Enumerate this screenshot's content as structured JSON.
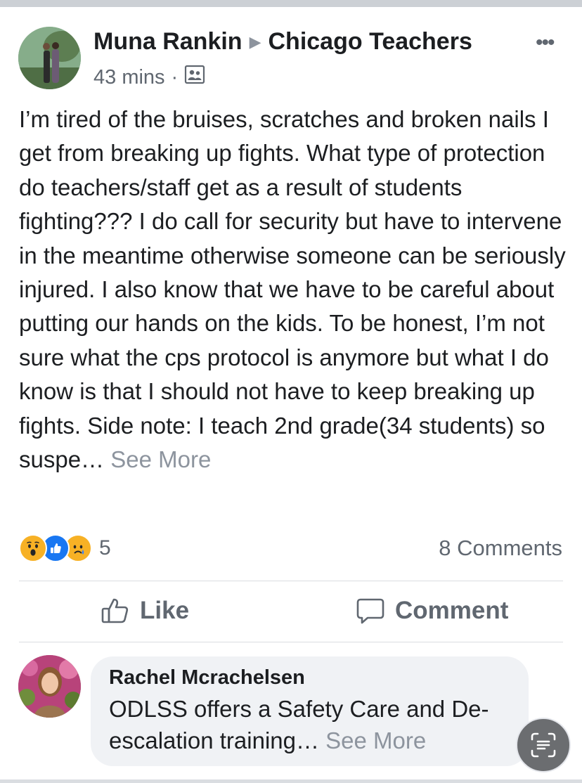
{
  "post": {
    "author": "Muna Rankin",
    "group": "Chicago Teachers",
    "time": "43 mins",
    "text": "I’m tired of the bruises, scratches and broken nails I get from breaking up fights. What type of protection do teachers/staff get as a result of students fighting??? I do call for security but have to intervene in the meantime otherwise someone can be seriously injured. I also know that we have to be careful about putting our hands on the kids. To be honest, I’m not sure what the cps protocol is anymore but what I do know is that I should not have to keep breaking up fights. Side note: I teach 2nd grade(34 students) so suspe…",
    "see_more": "See More",
    "privacy_icon": "group-members-icon",
    "more_icon": "more-dots-icon"
  },
  "reactions": {
    "icons": [
      "wow-icon",
      "like-icon",
      "sad-icon"
    ],
    "count": "5",
    "comments_count": "8 Comments"
  },
  "actions": {
    "like_label": "Like",
    "comment_label": "Comment"
  },
  "comment": {
    "author": "Rachel Mcrachelsen",
    "text": "ODLSS offers a Safety Care and De-escalation training…",
    "see_more": "See More"
  },
  "colors": {
    "secondary_text": "#606770",
    "muted_text": "#8d949e",
    "brand_blue": "#1877f2",
    "bubble_bg": "#f0f2f5"
  }
}
